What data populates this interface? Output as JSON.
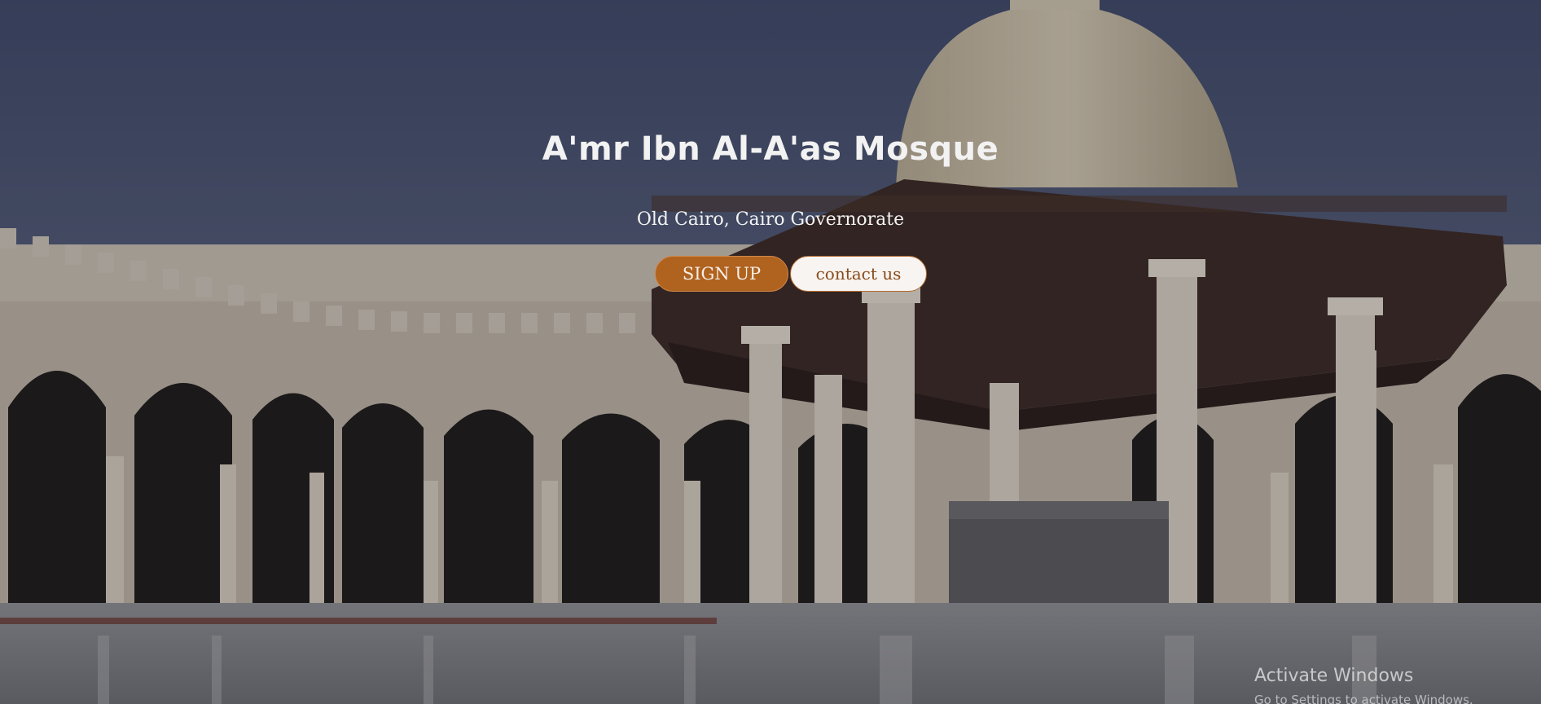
{
  "hero": {
    "title": "A'mr Ibn Al-A'as Mosque",
    "subtitle": "Old Cairo, Cairo Governorate",
    "buttons": {
      "signup_label": "SIGN UP",
      "contact_label": "contact us"
    }
  },
  "system": {
    "watermark_title": "Activate Windows",
    "watermark_subtitle": "Go to Settings to activate Windows."
  },
  "colors": {
    "signup_bg": "#b0621f",
    "contact_bg": "#f7f4f1",
    "contact_text": "#8a4b19",
    "title_text": "#f2f2f2"
  }
}
